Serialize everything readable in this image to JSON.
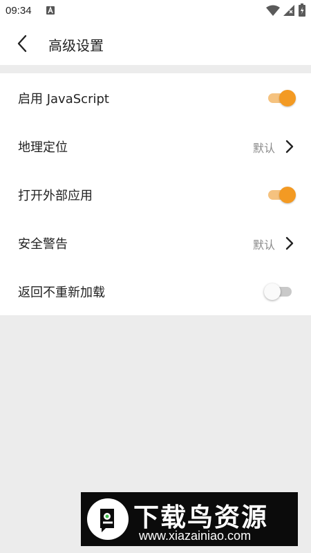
{
  "status_bar": {
    "time": "09:34",
    "notification_icon": "a-letter-icon",
    "wifi_icon": "wifi-icon",
    "signal_icon": "signal-icon",
    "battery_icon": "battery-charging-icon"
  },
  "header": {
    "back_icon": "chevron-left-icon",
    "title": "高级设置"
  },
  "settings": {
    "items": [
      {
        "label": "启用 JavaScript",
        "control": "toggle",
        "on": true
      },
      {
        "label": "地理定位",
        "control": "value",
        "value": "默认"
      },
      {
        "label": "打开外部应用",
        "control": "toggle",
        "on": true
      },
      {
        "label": "安全警告",
        "control": "value",
        "value": "默认"
      },
      {
        "label": "返回不重新加载",
        "control": "toggle",
        "on": false
      }
    ]
  },
  "colors": {
    "accent": "#f39a23",
    "accent_track": "#f5c27f",
    "toggle_off_track": "#c9c9c9",
    "background": "#ececec",
    "surface": "#ffffff"
  },
  "watermark": {
    "title": "下载鸟资源",
    "url": "www.xiazainiao.com"
  }
}
